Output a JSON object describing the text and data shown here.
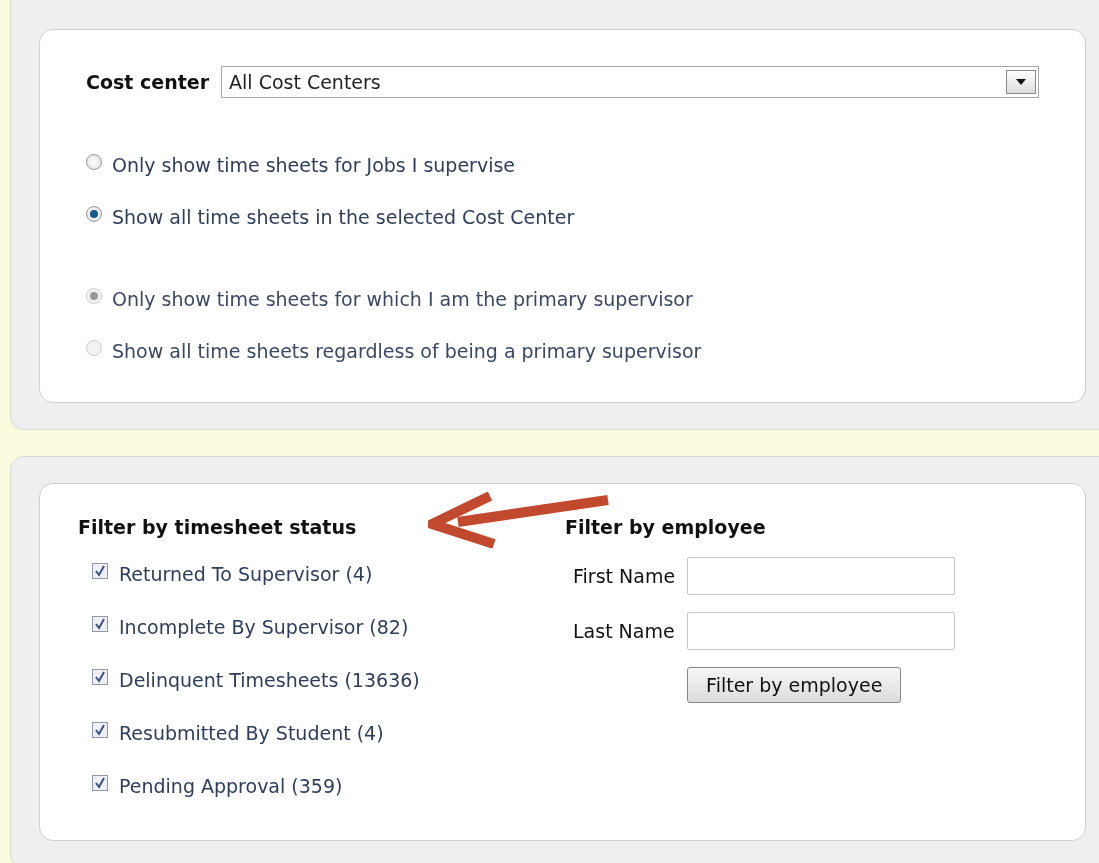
{
  "cost_center": {
    "label": "Cost center",
    "value": "All Cost Centers"
  },
  "scope_options": [
    {
      "label": "Only show time sheets for Jobs I supervise",
      "selected": false,
      "disabled": false
    },
    {
      "label": "Show all time sheets in the selected Cost Center",
      "selected": true,
      "disabled": false
    }
  ],
  "supervisor_options": [
    {
      "label": "Only show time sheets for which I am the primary supervisor",
      "selected": true,
      "disabled": true
    },
    {
      "label": "Show all time sheets regardless of being a primary supervisor",
      "selected": false,
      "disabled": true
    }
  ],
  "status_filter": {
    "title": "Filter by timesheet status",
    "items": [
      {
        "label": "Returned To Supervisor (4)",
        "checked": true
      },
      {
        "label": "Incomplete By Supervisor (82)",
        "checked": true
      },
      {
        "label": "Delinquent Timesheets (13636)",
        "checked": true
      },
      {
        "label": "Resubmitted By Student (4)",
        "checked": true
      },
      {
        "label": "Pending Approval (359)",
        "checked": true
      }
    ]
  },
  "employee_filter": {
    "title": "Filter by employee",
    "fields": [
      {
        "label": "First Name"
      },
      {
        "label": "Last Name"
      }
    ],
    "button": "Filter by employee"
  }
}
